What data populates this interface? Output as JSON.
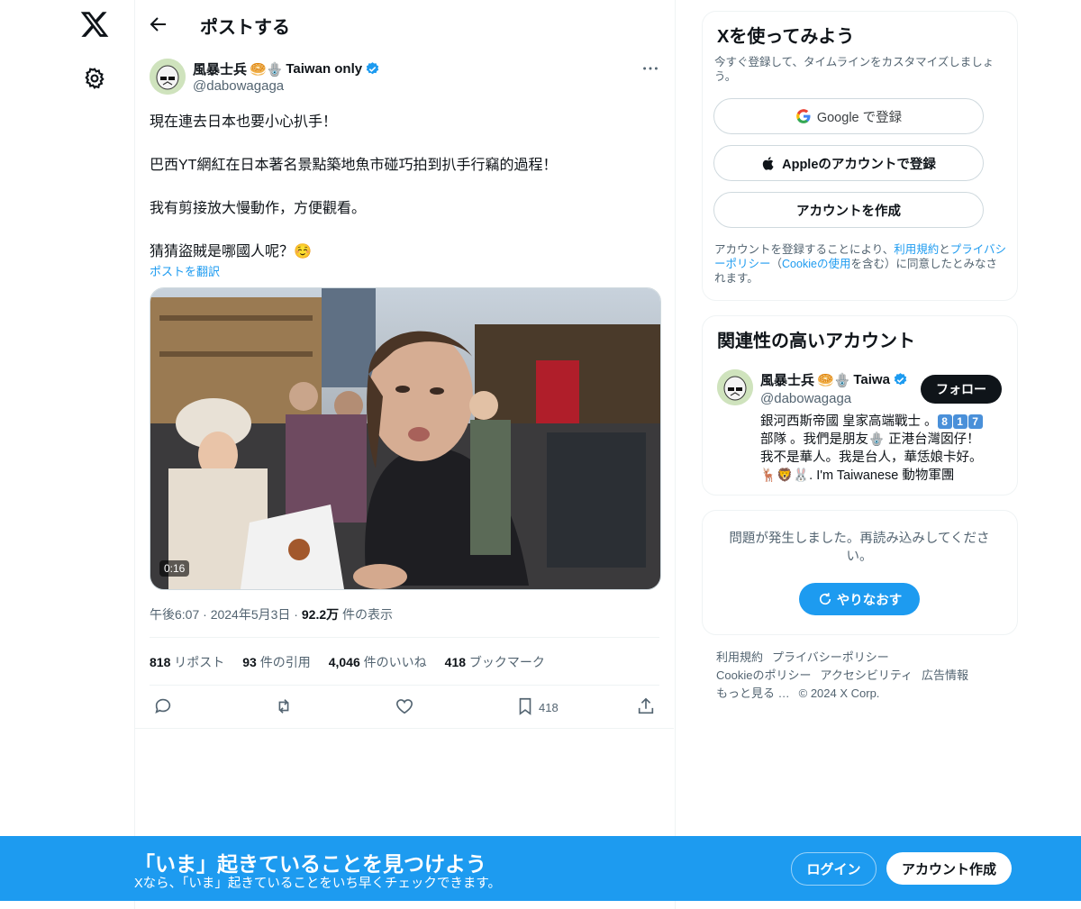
{
  "header": {
    "title": "ポストする"
  },
  "post": {
    "author_name": "風暴士兵",
    "author_name_suffix": "Taiwan only",
    "author_emojis": "🥯🪬",
    "handle": "@dabowagaga",
    "lines": [
      "現在連去日本也要小心扒手！",
      "巴西YT網紅在日本著名景點築地魚市碰巧拍到扒手行竊的過程！",
      "我有剪接放大慢動作，方便觀看。",
      "猜猜盜賊是哪國人呢？☺️"
    ],
    "translate_label": "ポストを翻訳",
    "video_duration": "0:16",
    "time": "午後6:07",
    "date": "2024年5月3日",
    "views_count": "92.2万",
    "views_label": "件の表示",
    "stats": [
      {
        "count": "818",
        "label": "リポスト"
      },
      {
        "count": "93",
        "label": "件の引用"
      },
      {
        "count": "4,046",
        "label": "件のいいね"
      },
      {
        "count": "418",
        "label": "ブックマーク"
      }
    ],
    "bookmark_count": "418"
  },
  "signup": {
    "title": "Xを使ってみよう",
    "subtitle": "今すぐ登録して、タイムラインをカスタマイズしましょう。",
    "google_label": "Google で登録",
    "apple_label": "Appleのアカウントで登録",
    "create_label": "アカウントを作成",
    "terms_prefix": "アカウントを登録することにより、",
    "terms_link1": "利用規約",
    "terms_and": "と",
    "terms_link2": "プライバシーポリシー",
    "terms_paren_open": "（",
    "terms_link3": "Cookieの使用",
    "terms_suffix": "を含む）に同意したとみなされます。"
  },
  "related": {
    "title": "関連性の高いアカウント",
    "name": "風暴士兵",
    "name_suffix": "Taiwa",
    "emojis": "🥯🪬",
    "handle": "@dabowagaga",
    "follow_label": "フォロー",
    "bio_line1_prefix": "銀河西斯帝國 皇家高端戰士 。",
    "bio_keycaps": [
      "8",
      "1",
      "7"
    ],
    "bio_line2": "部隊 。我們是朋友🪬 正港台灣囡仔！",
    "bio_line3": "我不是華人。我是台人，華恁娘卡好。",
    "bio_line4": "🦌🦁🐰. I'm Taiwanese 動物軍團"
  },
  "error": {
    "text": "問題が発生しました。再読み込みしてください。",
    "retry_label": "やりなおす"
  },
  "footer": {
    "links": [
      "利用規約",
      "プライバシーポリシー",
      "Cookieのポリシー",
      "アクセシビリティ",
      "広告情報",
      "もっと見る …",
      "© 2024 X Corp."
    ]
  },
  "banner": {
    "title": "「いま」起きていることを見つけよう",
    "subtitle": "Xなら、「いま」起きていることをいち早くチェックできます。",
    "login_label": "ログイン",
    "signup_label": "アカウント作成"
  },
  "colors": {
    "accent": "#1d9bf0",
    "text": "#0f1419",
    "muted": "#536471"
  }
}
